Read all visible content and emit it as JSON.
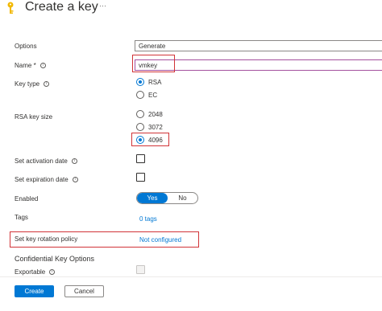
{
  "header": {
    "title": "Create a key",
    "more_label": "···"
  },
  "form": {
    "options": {
      "label": "Options",
      "value": "Generate"
    },
    "name": {
      "label": "Name *",
      "value": "vmkey"
    },
    "key_type": {
      "label": "Key type",
      "options": [
        "RSA",
        "EC"
      ],
      "selected": "RSA"
    },
    "rsa_key_size": {
      "label": "RSA key size",
      "options": [
        "2048",
        "3072",
        "4096"
      ],
      "selected": "4096"
    },
    "activation": {
      "label": "Set activation date",
      "checked": false
    },
    "expiration": {
      "label": "Set expiration date",
      "checked": false
    },
    "enabled": {
      "label": "Enabled",
      "yes": "Yes",
      "no": "No",
      "selected": "Yes"
    },
    "tags": {
      "label": "Tags",
      "value": "0 tags"
    },
    "rotation": {
      "label": "Set key rotation policy",
      "value": "Not configured"
    },
    "confidential": {
      "heading": "Confidential Key Options"
    },
    "exportable": {
      "label": "Exportable",
      "checked": false
    }
  },
  "footer": {
    "create_label": "Create",
    "cancel_label": "Cancel"
  },
  "colors": {
    "accent": "#0078d4",
    "highlight": "#d13438",
    "key_icon": "#f2b800"
  }
}
